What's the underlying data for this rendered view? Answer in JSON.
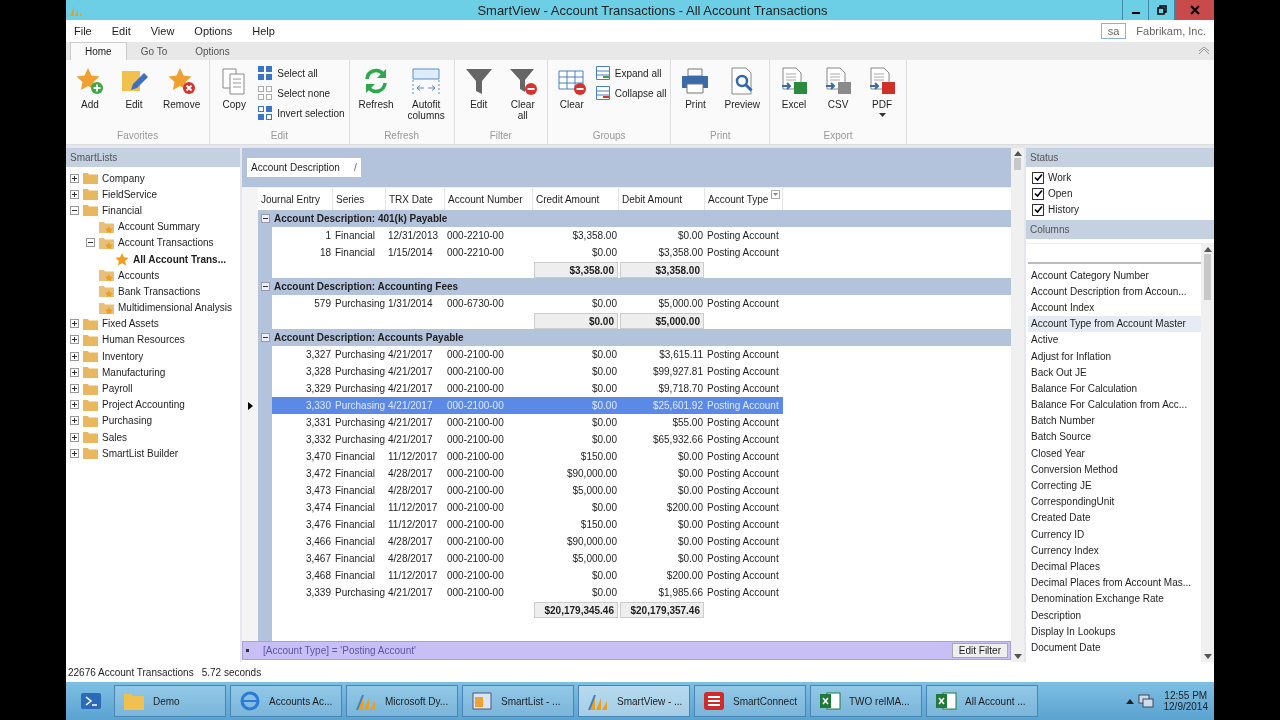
{
  "window": {
    "title": "SmartView - Account Transactions - All Account Transactions"
  },
  "menu": [
    "File",
    "Edit",
    "View",
    "Options",
    "Help"
  ],
  "user": {
    "login": "sa",
    "company": "Fabrikam, Inc."
  },
  "ribbon": {
    "tabs": [
      {
        "label": "Home",
        "selected": true
      },
      {
        "label": "Go To",
        "selected": false
      },
      {
        "label": "Options",
        "selected": false
      }
    ],
    "groups": [
      {
        "label": "Favorites",
        "items": [
          {
            "kind": "large",
            "label": "Add"
          },
          {
            "kind": "large",
            "label": "Edit"
          },
          {
            "kind": "large",
            "label": "Remove"
          }
        ]
      },
      {
        "label": "Edit",
        "items": [
          {
            "kind": "large",
            "label": "Copy"
          },
          {
            "kind": "small",
            "label": "Select all"
          },
          {
            "kind": "small",
            "label": "Select none"
          },
          {
            "kind": "small",
            "label": "Invert selection"
          }
        ]
      },
      {
        "label": "Refresh",
        "items": [
          {
            "kind": "large",
            "label": "Refresh"
          },
          {
            "kind": "large",
            "label": "Autofit columns"
          }
        ]
      },
      {
        "label": "Filter",
        "items": [
          {
            "kind": "large",
            "label": "Edit"
          },
          {
            "kind": "large",
            "label": "Clear all"
          }
        ]
      },
      {
        "label": "Groups",
        "items": [
          {
            "kind": "large",
            "label": "Clear"
          },
          {
            "kind": "small",
            "label": "Expand all"
          },
          {
            "kind": "small",
            "label": "Collapse all"
          }
        ]
      },
      {
        "label": "Print",
        "items": [
          {
            "kind": "large",
            "label": "Print"
          },
          {
            "kind": "large",
            "label": "Preview"
          }
        ]
      },
      {
        "label": "Export",
        "items": [
          {
            "kind": "large",
            "label": "Excel"
          },
          {
            "kind": "large",
            "label": "CSV"
          },
          {
            "kind": "split",
            "label": "PDF"
          }
        ]
      }
    ]
  },
  "tree": {
    "title": "SmartLists",
    "items": [
      {
        "label": "Company",
        "kind": "folder",
        "expanded": false,
        "selected": false
      },
      {
        "label": "FieldService",
        "kind": "folder",
        "expanded": false,
        "selected": false
      },
      {
        "label": "Financial",
        "kind": "folder",
        "expanded": true,
        "selected": false,
        "children": [
          {
            "label": "Account Summary",
            "kind": "smartlist",
            "selected": false
          },
          {
            "label": "Account Transactions",
            "kind": "smartlist",
            "expanded": true,
            "selected": false,
            "children": [
              {
                "label": "All Account Trans...",
                "kind": "favorite",
                "selected": true
              }
            ]
          },
          {
            "label": "Accounts",
            "kind": "smartlist",
            "selected": false
          },
          {
            "label": "Bank Transactions",
            "kind": "smartlist",
            "selected": false
          },
          {
            "label": "Multidimensional  Analysis",
            "kind": "smartlist",
            "selected": false
          }
        ]
      },
      {
        "label": "Fixed Assets",
        "kind": "folder",
        "expanded": false,
        "selected": false
      },
      {
        "label": "Human Resources",
        "kind": "folder",
        "expanded": false,
        "selected": false
      },
      {
        "label": "Inventory",
        "kind": "folder",
        "expanded": false,
        "selected": false
      },
      {
        "label": "Manufacturing",
        "kind": "folder",
        "expanded": false,
        "selected": false
      },
      {
        "label": "Payroll",
        "kind": "folder",
        "expanded": false,
        "selected": false
      },
      {
        "label": "Project Accounting",
        "kind": "folder",
        "expanded": false,
        "selected": false
      },
      {
        "label": "Purchasing",
        "kind": "folder",
        "expanded": false,
        "selected": false
      },
      {
        "label": "Sales",
        "kind": "folder",
        "expanded": false,
        "selected": false
      },
      {
        "label": "SmartList Builder",
        "kind": "folder",
        "expanded": false,
        "selected": false
      }
    ]
  },
  "grid": {
    "group_by": "Account Description",
    "sort_mark": "/",
    "columns": [
      {
        "label": "Journal Entry",
        "filter": false
      },
      {
        "label": "Series",
        "filter": false
      },
      {
        "label": "TRX Date",
        "filter": false
      },
      {
        "label": "Account Number",
        "filter": false
      },
      {
        "label": "Credit Amount",
        "filter": false
      },
      {
        "label": "Debit Amount",
        "filter": false
      },
      {
        "label": "Account Type",
        "filter": true
      }
    ],
    "groups": [
      {
        "title": "Account Description: 401(k) Payable",
        "expanded": true,
        "rows": [
          {
            "selected": false,
            "cells": [
              "1",
              "Financial",
              "12/31/2013",
              "000-2210-00",
              "$3,358.00",
              "$0.00",
              "Posting Account"
            ]
          },
          {
            "selected": false,
            "cells": [
              "18",
              "Financial",
              "1/15/2014",
              "000-2210-00",
              "$0.00",
              "$3,358.00",
              "Posting Account"
            ]
          }
        ],
        "totals": [
          "$3,358.00",
          "$3,358.00"
        ]
      },
      {
        "title": "Account Description: Accounting Fees",
        "expanded": true,
        "rows": [
          {
            "selected": false,
            "cells": [
              "579",
              "Purchasing",
              "1/31/2014",
              "000-6730-00",
              "$0.00",
              "$5,000.00",
              "Posting Account"
            ]
          }
        ],
        "totals": [
          "$0.00",
          "$5,000.00"
        ]
      },
      {
        "title": "Account Description: Accounts Payable",
        "expanded": true,
        "rows": [
          {
            "selected": false,
            "cells": [
              "3,327",
              "Purchasing",
              "4/21/2017",
              "000-2100-00",
              "$0.00",
              "$3,615.11",
              "Posting Account"
            ]
          },
          {
            "selected": false,
            "cells": [
              "3,328",
              "Purchasing",
              "4/21/2017",
              "000-2100-00",
              "$0.00",
              "$99,927.81",
              "Posting Account"
            ]
          },
          {
            "selected": false,
            "cells": [
              "3,329",
              "Purchasing",
              "4/21/2017",
              "000-2100-00",
              "$0.00",
              "$9,718.70",
              "Posting Account"
            ]
          },
          {
            "selected": true,
            "cells": [
              "3,330",
              "Purchasing",
              "4/21/2017",
              "000-2100-00",
              "$0.00",
              "$25,601.92",
              "Posting Account"
            ]
          },
          {
            "selected": false,
            "cells": [
              "3,331",
              "Purchasing",
              "4/21/2017",
              "000-2100-00",
              "$0.00",
              "$55.00",
              "Posting Account"
            ]
          },
          {
            "selected": false,
            "cells": [
              "3,332",
              "Purchasing",
              "4/21/2017",
              "000-2100-00",
              "$0.00",
              "$65,932.66",
              "Posting Account"
            ]
          },
          {
            "selected": false,
            "cells": [
              "3,470",
              "Financial",
              "11/12/2017",
              "000-2100-00",
              "$150.00",
              "$0.00",
              "Posting Account"
            ]
          },
          {
            "selected": false,
            "cells": [
              "3,472",
              "Financial",
              "4/28/2017",
              "000-2100-00",
              "$90,000.00",
              "$0.00",
              "Posting Account"
            ]
          },
          {
            "selected": false,
            "cells": [
              "3,473",
              "Financial",
              "4/28/2017",
              "000-2100-00",
              "$5,000.00",
              "$0.00",
              "Posting Account"
            ]
          },
          {
            "selected": false,
            "cells": [
              "3,474",
              "Financial",
              "11/12/2017",
              "000-2100-00",
              "$0.00",
              "$200.00",
              "Posting Account"
            ]
          },
          {
            "selected": false,
            "cells": [
              "3,476",
              "Financial",
              "11/12/2017",
              "000-2100-00",
              "$150.00",
              "$0.00",
              "Posting Account"
            ]
          },
          {
            "selected": false,
            "cells": [
              "3,466",
              "Financial",
              "4/28/2017",
              "000-2100-00",
              "$90,000.00",
              "$0.00",
              "Posting Account"
            ]
          },
          {
            "selected": false,
            "cells": [
              "3,467",
              "Financial",
              "4/28/2017",
              "000-2100-00",
              "$5,000.00",
              "$0.00",
              "Posting Account"
            ]
          },
          {
            "selected": false,
            "cells": [
              "3,468",
              "Financial",
              "11/12/2017",
              "000-2100-00",
              "$0.00",
              "$200.00",
              "Posting Account"
            ]
          },
          {
            "selected": false,
            "cells": [
              "3,339",
              "Purchasing",
              "4/21/2017",
              "000-2100-00",
              "$0.00",
              "$1,985.66",
              "Posting Account"
            ]
          }
        ]
      }
    ],
    "grand_totals": [
      "$20,179,345.46",
      "$20,179,357.46"
    ],
    "filter": {
      "text": "[Account Type] = 'Posting Account'",
      "button": "Edit Filter"
    }
  },
  "side": {
    "status": {
      "title": "Status",
      "options": [
        {
          "label": "Work",
          "checked": true
        },
        {
          "label": "Open",
          "checked": true
        },
        {
          "label": "History",
          "checked": true
        }
      ]
    },
    "columns": {
      "title": "Columns",
      "items": [
        {
          "label": "Account Category Number",
          "selected": false
        },
        {
          "label": "Account Description from Accoun...",
          "selected": false
        },
        {
          "label": "Account Index",
          "selected": false
        },
        {
          "label": "Account Type from Account Master",
          "selected": true
        },
        {
          "label": "Active",
          "selected": false
        },
        {
          "label": "Adjust for Inflation",
          "selected": false
        },
        {
          "label": "Back Out JE",
          "selected": false
        },
        {
          "label": "Balance For Calculation",
          "selected": false
        },
        {
          "label": "Balance For Calculation from Acc...",
          "selected": false
        },
        {
          "label": "Batch Number",
          "selected": false
        },
        {
          "label": "Batch Source",
          "selected": false
        },
        {
          "label": "Closed Year",
          "selected": false
        },
        {
          "label": "Conversion Method",
          "selected": false
        },
        {
          "label": "Correcting JE",
          "selected": false
        },
        {
          "label": "CorrespondingUnit",
          "selected": false
        },
        {
          "label": "Created Date",
          "selected": false
        },
        {
          "label": "Currency ID",
          "selected": false
        },
        {
          "label": "Currency Index",
          "selected": false
        },
        {
          "label": "Decimal Places",
          "selected": false
        },
        {
          "label": "Decimal Places from Account Mas...",
          "selected": false
        },
        {
          "label": "Denomination Exchange Rate",
          "selected": false
        },
        {
          "label": "Description",
          "selected": false
        },
        {
          "label": "Display In Lookups",
          "selected": false
        },
        {
          "label": "Document Date",
          "selected": false
        }
      ]
    }
  },
  "status_bar": {
    "count": "22676 Account Transactions",
    "time": "5.72 seconds"
  },
  "taskbar": {
    "items": [
      {
        "label": "Demo",
        "selected": false
      },
      {
        "label": "Accounts Ac...",
        "selected": false
      },
      {
        "label": "Microsoft Dy...",
        "selected": false
      },
      {
        "label": "SmartList - ...",
        "selected": false
      },
      {
        "label": "SmartView - ...",
        "selected": true
      },
      {
        "label": "SmartConnect",
        "selected": false
      },
      {
        "label": "TWO relMA...",
        "selected": false
      },
      {
        "label": "All Account ...",
        "selected": false
      }
    ],
    "time": "12:55 PM",
    "date": "12/9/2014"
  }
}
